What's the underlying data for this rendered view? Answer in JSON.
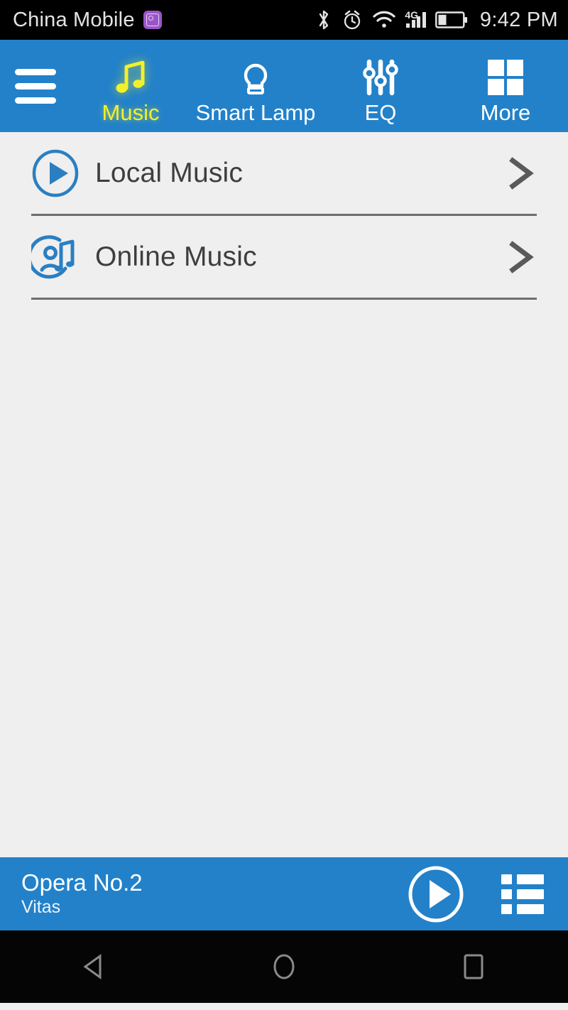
{
  "statusbar": {
    "carrier": "China Mobile",
    "sim_icon": "screenshot-badge-icon",
    "bluetooth_icon": "bluetooth-icon",
    "alarm_icon": "alarm-clock-icon",
    "wifi_icon": "wifi-icon",
    "network_type": "4G",
    "signal_icon": "signal-bars-icon",
    "battery_icon": "battery-icon",
    "time": "9:42 PM"
  },
  "topnav": {
    "menu_icon": "hamburger-menu-icon",
    "tabs": [
      {
        "label": "Music",
        "icon": "music-note-icon",
        "active": true
      },
      {
        "label": "Smart Lamp",
        "icon": "lamp-icon",
        "active": false
      },
      {
        "label": "EQ",
        "icon": "equalizer-sliders-icon",
        "active": false
      },
      {
        "label": "More",
        "icon": "grid-squares-icon",
        "active": false
      }
    ]
  },
  "list": {
    "items": [
      {
        "label": "Local Music",
        "icon": "play-circle-icon",
        "chevron": "chevron-right-icon"
      },
      {
        "label": "Online Music",
        "icon": "online-music-icon",
        "chevron": "chevron-right-icon"
      }
    ]
  },
  "player": {
    "title": "Opera No.2",
    "artist": "Vitas",
    "play_icon": "play-circle-icon",
    "playlist_icon": "playlist-icon"
  },
  "navbar": {
    "back": "back-triangle-icon",
    "home": "home-circle-icon",
    "recents": "recents-square-icon"
  },
  "colors": {
    "accent_blue": "#2281c9",
    "active_yellow": "#f2f02a",
    "content_bg": "#efefef",
    "icon_blue": "#2a7fc2",
    "text_dark": "#3e3e3e"
  }
}
